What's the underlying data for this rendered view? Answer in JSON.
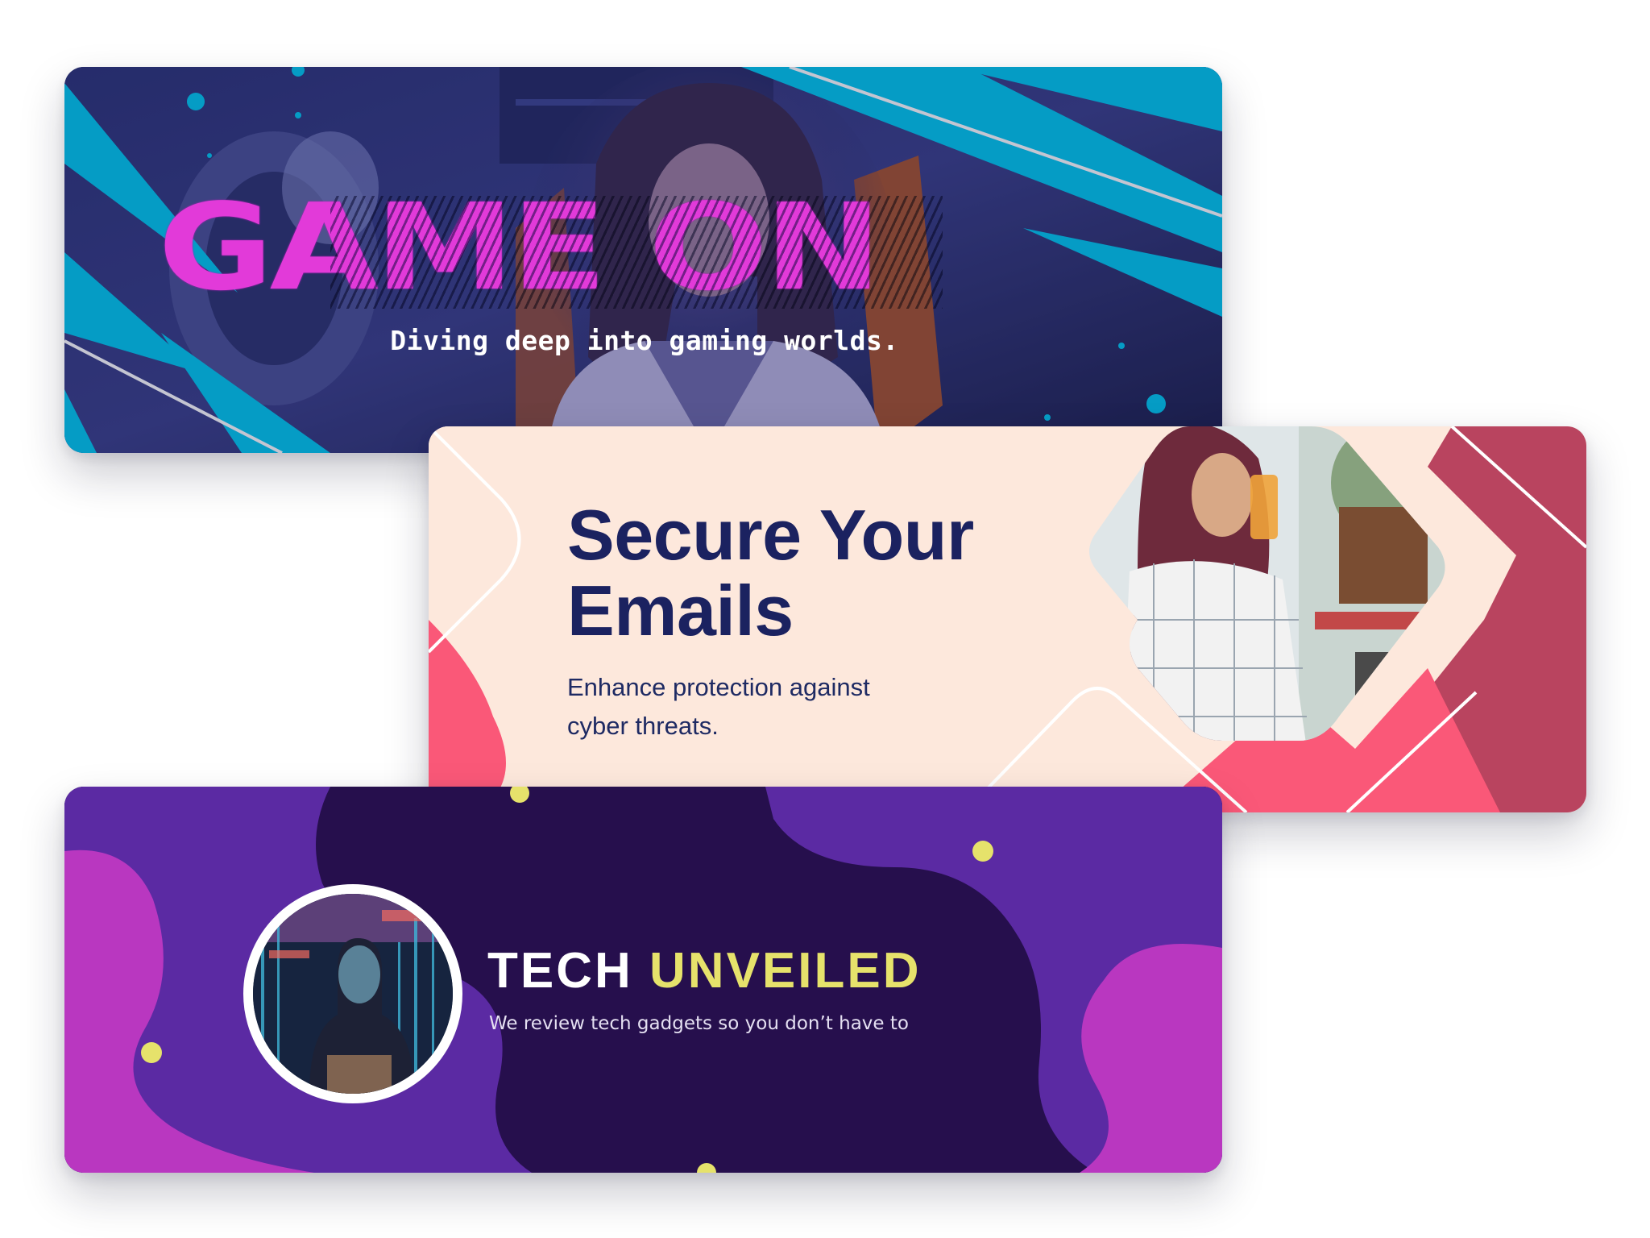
{
  "banners": {
    "gaming": {
      "title": "GAME ON",
      "subtitle": "Diving deep into gaming worlds."
    },
    "email": {
      "title": "Secure Your Emails",
      "subtitle": "Enhance protection against cyber threats."
    },
    "tech": {
      "title_part1": "TECH",
      "title_part2": "UNVEILED",
      "subtitle": "We review tech gadgets so you don’t have to"
    }
  },
  "colors": {
    "gaming_accent_cyan": "#00c8ef",
    "gaming_title_magenta": "#e23ad9",
    "email_background": "#fde8dc",
    "email_title_navy": "#1b2260",
    "email_accent_pink": "#fa5878",
    "email_accent_berry": "#b9445f",
    "tech_background": "#260f4d",
    "tech_blob_purple": "#5b2aa3",
    "tech_blob_magenta": "#b937c0",
    "tech_accent_yellow": "#e6e26b"
  }
}
